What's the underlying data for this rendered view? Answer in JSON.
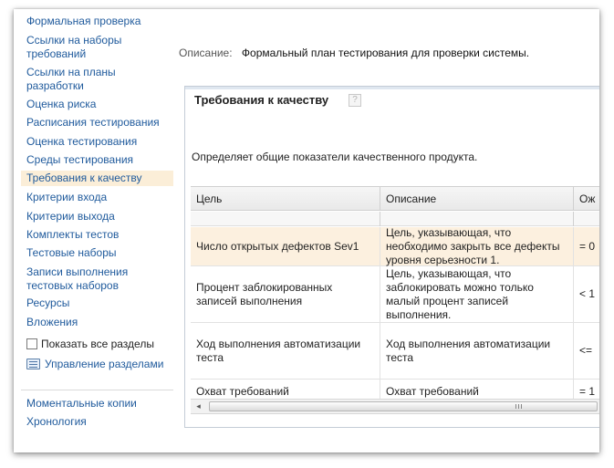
{
  "sidebar": {
    "items": [
      {
        "label": "Формальная проверка"
      },
      {
        "label": "Ссылки на наборы требований"
      },
      {
        "label": "Ссылки на планы разработки"
      },
      {
        "label": "Оценка риска"
      },
      {
        "label": "Расписания тестирования"
      },
      {
        "label": "Оценка тестирования"
      },
      {
        "label": "Среды тестирования"
      },
      {
        "label": "Требования к качеству",
        "selected": true
      },
      {
        "label": "Критерии входа"
      },
      {
        "label": "Критерии выхода"
      },
      {
        "label": "Комплекты тестов"
      },
      {
        "label": "Тестовые наборы"
      },
      {
        "label": "Записи выполнения тестовых наборов"
      },
      {
        "label": "Ресурсы"
      },
      {
        "label": "Вложения"
      }
    ],
    "show_all_label": "Показать все разделы",
    "show_all_checked": false,
    "manage_label": "Управление разделами",
    "manage_icon": "list-icon",
    "bottom_links": [
      {
        "label": "Моментальные копии"
      },
      {
        "label": "Хронология"
      }
    ]
  },
  "description": {
    "label": "Описание:",
    "value": "Формальный план тестирования для проверки системы."
  },
  "section": {
    "title": "Требования к качеству",
    "help_icon": "help-icon",
    "help_glyph": "?",
    "description": "Определяет общие показатели качественного продукта.",
    "columns": [
      "Цель",
      "Описание",
      "Ож"
    ],
    "rows": [
      {
        "goal": "Число открытых дефектов Sev1",
        "description": "Цель, указывающая, что необходимо закрыть все дефекты уровня серьезности 1.",
        "expected": "= 0",
        "selected": true
      },
      {
        "goal": "Процент заблокированных записей выполнения",
        "description": "Цель, указывающая, что заблокировать можно только малый процент записей выполнения.",
        "expected": "< 1"
      },
      {
        "goal": "Ход выполнения автоматизации теста",
        "description": "Ход выполнения автоматизации теста",
        "expected": "<="
      },
      {
        "goal": "Охват требований",
        "description": "Охват требований",
        "expected": "= 1"
      }
    ]
  },
  "scrollbar": {
    "left_arrow": "◂",
    "right_arrow": "▸"
  }
}
